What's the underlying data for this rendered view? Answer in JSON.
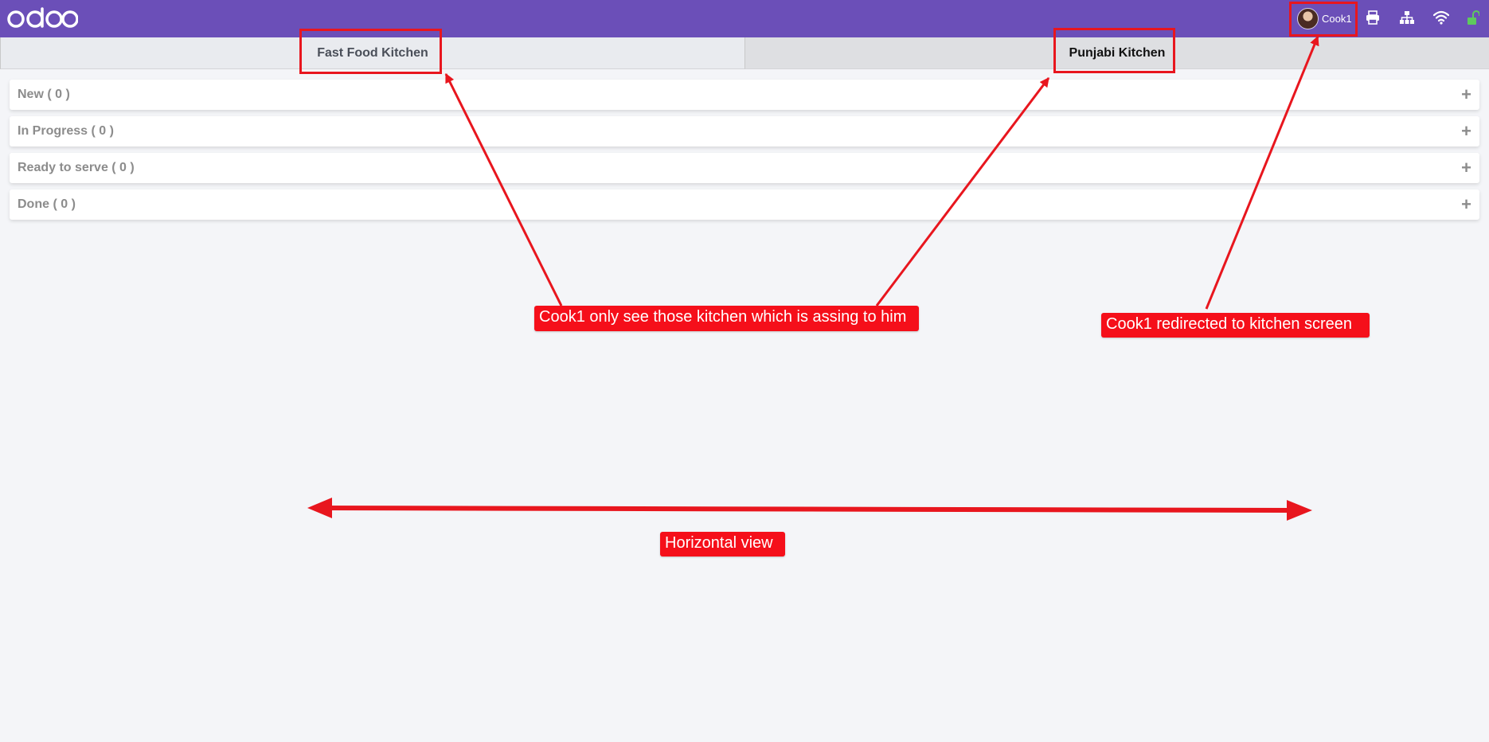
{
  "app": {
    "logo_text": "odoo"
  },
  "topbar": {
    "user_name": "Cook1",
    "icons": [
      "printer-icon",
      "network-icon",
      "wifi-icon",
      "unlock-icon"
    ],
    "bg_color": "#6b4fb8"
  },
  "tabs": [
    {
      "label": "Fast Food Kitchen"
    },
    {
      "label": "Punjabi Kitchen"
    }
  ],
  "stages": [
    {
      "label": "New ( 0 )"
    },
    {
      "label": "In Progress ( 0 )"
    },
    {
      "label": "Ready to serve ( 0 )"
    },
    {
      "label": "Done ( 0 )"
    }
  ],
  "annotations": {
    "kitchens_note": "Cook1 only see those kitchen which is assing to him",
    "redirect_note": "Cook1 redirected to kitchen screen",
    "horizontal_note": "Horizontal view",
    "color": "#f50f1a"
  }
}
